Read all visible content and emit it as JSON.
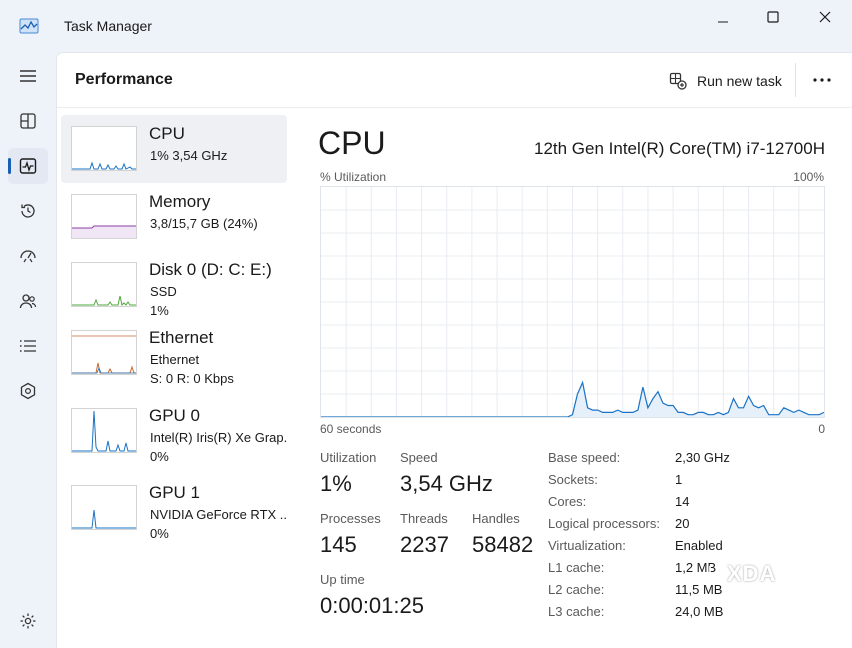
{
  "window": {
    "title": "Task Manager",
    "icon": "task-manager-app-icon"
  },
  "nav": {
    "items": [
      {
        "name": "hamburger-menu",
        "icon": "hamburger-icon"
      },
      {
        "name": "processes",
        "icon": "processes-grid-icon"
      },
      {
        "name": "performance",
        "icon": "performance-monitor-icon",
        "active": true
      },
      {
        "name": "app-history",
        "icon": "history-clock-icon"
      },
      {
        "name": "startup-apps",
        "icon": "startup-speedometer-icon"
      },
      {
        "name": "users",
        "icon": "users-icon"
      },
      {
        "name": "details",
        "icon": "list-details-icon"
      },
      {
        "name": "services",
        "icon": "puzzle-services-icon"
      },
      {
        "name": "settings",
        "icon": "gear-icon"
      }
    ]
  },
  "header": {
    "title": "Performance",
    "run_new_task": "Run new task",
    "more_options": "more-options-icon"
  },
  "devices": [
    {
      "id": "cpu",
      "name": "CPU",
      "line1": "1%  3,54 GHz",
      "line2": "",
      "color": "#1a73c4",
      "active": true
    },
    {
      "id": "memory",
      "name": "Memory",
      "line1": "3,8/15,7 GB (24%)",
      "line2": "",
      "color": "#8b3fa6"
    },
    {
      "id": "disk0",
      "name": "Disk 0 (D: C: E:)",
      "line1": "SSD",
      "line2": "1%",
      "color": "#4fa83d"
    },
    {
      "id": "ethernet",
      "name": "Ethernet",
      "line1": "Ethernet",
      "line2": "S: 0  R: 0 Kbps",
      "color": "#c86a2c"
    },
    {
      "id": "gpu0",
      "name": "GPU 0",
      "line1": "Intel(R) Iris(R) Xe Grap...",
      "line2": "0%",
      "color": "#1a73c4"
    },
    {
      "id": "gpu1",
      "name": "GPU 1",
      "line1": "NVIDIA GeForce RTX ...",
      "line2": "0%",
      "color": "#1a73c4"
    }
  ],
  "cpu_panel": {
    "title": "CPU",
    "model": "12th Gen Intel(R) Core(TM) i7-12700H",
    "util_label": "% Utilization",
    "max_label": "100%",
    "time_label": "60 seconds",
    "min_label": "0",
    "line_color": "#1a73c4",
    "fill_color": "#e6f0fa",
    "grid_color": "#e8ecf2",
    "graph_values": [
      0,
      0,
      0,
      0,
      0,
      0,
      0,
      0,
      0,
      0,
      0,
      0,
      0,
      0,
      0,
      0,
      0,
      0,
      0,
      0,
      0,
      0,
      0,
      0,
      0,
      0,
      0,
      0,
      0,
      0,
      0,
      0,
      0,
      0,
      0,
      0,
      0,
      0,
      0,
      0,
      0,
      0,
      0,
      0,
      0,
      0,
      0,
      0,
      0,
      0,
      1,
      10,
      15,
      4,
      3,
      3,
      2,
      2,
      2,
      3,
      2,
      2,
      2,
      3,
      13,
      4,
      8,
      11,
      6,
      5,
      5,
      2,
      2,
      1,
      1,
      2,
      2,
      1,
      1,
      2,
      1,
      2,
      8,
      4,
      4,
      9,
      5,
      4,
      5,
      1,
      1,
      1,
      4,
      3,
      2,
      3,
      2,
      1,
      1,
      1,
      2
    ],
    "stats": {
      "utilization_label": "Utilization",
      "utilization": "1%",
      "speed_label": "Speed",
      "speed": "3,54 GHz",
      "processes_label": "Processes",
      "processes": "145",
      "threads_label": "Threads",
      "threads": "2237",
      "handles_label": "Handles",
      "handles": "58482",
      "uptime_label": "Up time",
      "uptime": "0:00:01:25"
    },
    "specs": [
      {
        "k": "Base speed:",
        "v": "2,30 GHz"
      },
      {
        "k": "Sockets:",
        "v": "1"
      },
      {
        "k": "Cores:",
        "v": "14"
      },
      {
        "k": "Logical processors:",
        "v": "20"
      },
      {
        "k": "Virtualization:",
        "v": "Enabled"
      },
      {
        "k": "L1 cache:",
        "v": "1,2 MB"
      },
      {
        "k": "L2 cache:",
        "v": "11,5 MB"
      },
      {
        "k": "L3 cache:",
        "v": "24,0 MB"
      }
    ]
  },
  "watermark": {
    "text": "XDA",
    "icon": "xda-logo-icon"
  }
}
